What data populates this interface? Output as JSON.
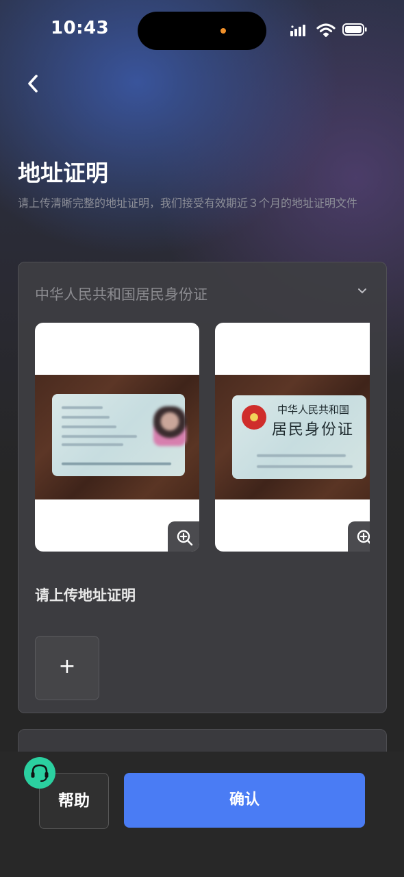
{
  "status_bar": {
    "time": "10:43",
    "icons": [
      "signal-icon",
      "wifi-icon",
      "battery-icon"
    ]
  },
  "nav": {
    "back_icon": "chevron-left-icon"
  },
  "page": {
    "title": "地址证明",
    "subtitle": "请上传清晰完整的地址证明，我们接受有效期近３个月的地址证明文件"
  },
  "document_card": {
    "selected_type": "中华人民共和国居民身份证",
    "dropdown_icon": "chevron-down-icon",
    "samples": [
      {
        "name": "id-card-front",
        "zoom_icon": "zoom-in-icon"
      },
      {
        "name": "id-card-back",
        "card_title_line1": "中华人民共和国",
        "card_title_line2": "居民身份证",
        "zoom_icon": "zoom-in-icon"
      }
    ],
    "upload_label": "请上传地址证明",
    "add_button": "+"
  },
  "footer": {
    "help_label": "帮助",
    "help_icon": "headset-icon",
    "confirm_label": "确认"
  },
  "colors": {
    "accent": "#4a7cf4",
    "help_badge": "#2bd0a0",
    "card_bg": "#3e3e42"
  }
}
